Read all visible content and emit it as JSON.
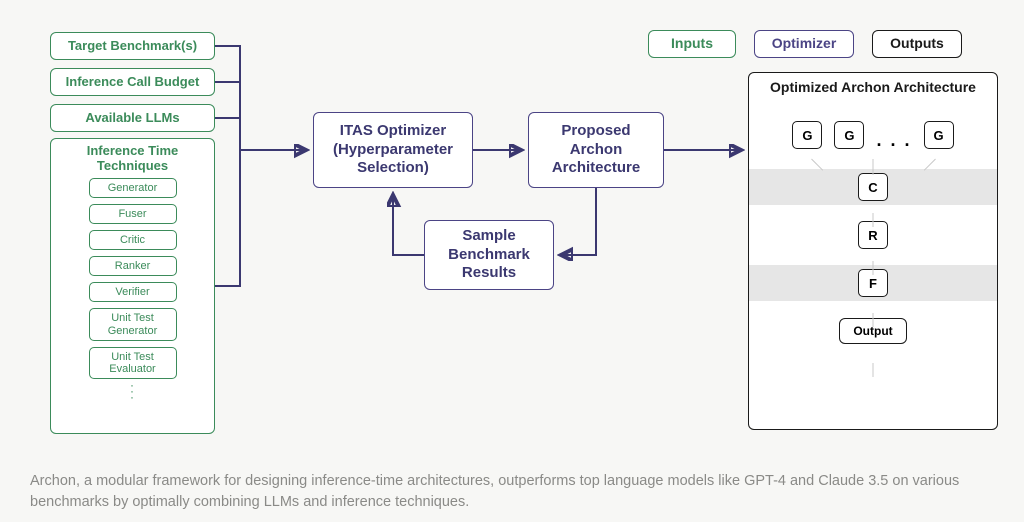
{
  "legend": {
    "inputs": "Inputs",
    "optimizer": "Optimizer",
    "outputs": "Outputs"
  },
  "inputs": {
    "target_benchmarks": "Target Benchmark(s)",
    "inference_budget": "Inference Call Budget",
    "available_llms": "Available LLMs",
    "techniques_title": "Inference Time Techniques",
    "techniques": [
      "Generator",
      "Fuser",
      "Critic",
      "Ranker",
      "Verifier",
      "Unit Test Generator",
      "Unit Test Evaluator"
    ]
  },
  "optimizer": {
    "itas": "ITAS Optimizer (Hyperparameter Selection)",
    "proposed": "Proposed Archon Architecture",
    "sample": "Sample Benchmark Results"
  },
  "output_arch": {
    "title": "Optimized Archon Architecture",
    "g": "G",
    "c": "C",
    "r": "R",
    "f": "F",
    "dots": ". . .",
    "output": "Output"
  },
  "caption": "Archon, a modular framework for designing inference-time architectures, outperforms top language models like GPT-4 and Claude 3.5 on various benchmarks by optimally combining LLMs and inference techniques."
}
